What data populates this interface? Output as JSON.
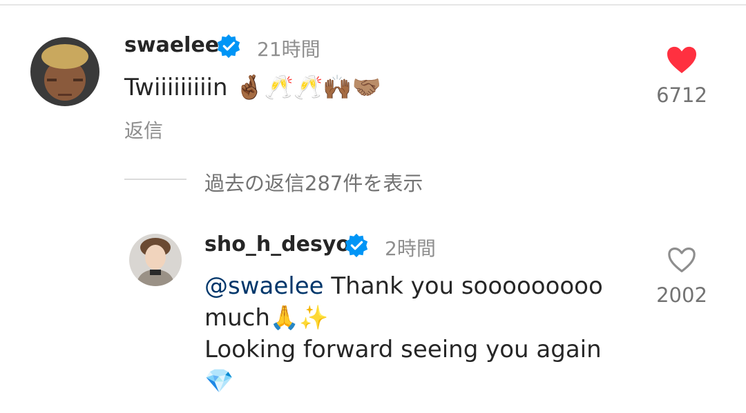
{
  "comment": {
    "username": "swaelee",
    "time": "21時間",
    "text": "Twiiiiiiiiin 🤞🏾🥂🥂🙌🏾🤝🏽",
    "reply_label": "返信",
    "like_count": "6712",
    "liked": true,
    "icons": {
      "verified": "verified-badge-icon",
      "like": "heart-filled-icon"
    }
  },
  "view_replies": {
    "label": "過去の返信287件を表示"
  },
  "reply": {
    "username": "sho_h_desyo",
    "time": "2時間",
    "mention": "@swaelee",
    "text_line1": " Thank you sooooooooo",
    "text_line2": "much🙏✨",
    "text_line3": "Looking forward seeing you again",
    "text_line4": "💎",
    "like_count": "2002",
    "liked": false,
    "icons": {
      "verified": "verified-badge-icon",
      "like": "heart-outline-icon"
    }
  },
  "colors": {
    "accent_blue": "#0095f6",
    "like_red": "#ff3040",
    "mention": "#00376b"
  }
}
